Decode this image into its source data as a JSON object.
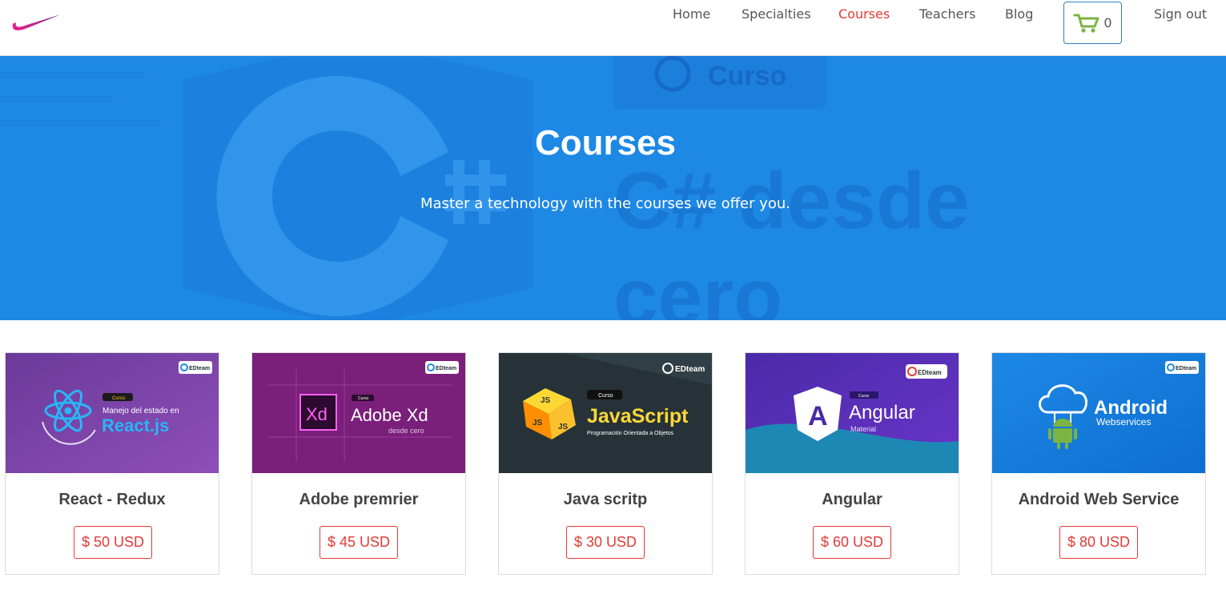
{
  "nav": {
    "items": [
      "Home",
      "Specialties",
      "Courses",
      "Teachers",
      "Blog"
    ],
    "cart_count": "0",
    "sign_out": "Sign out",
    "accent_color": "#e53935"
  },
  "hero": {
    "title": "Courses",
    "subtitle": "Master a technology with the courses we offer you.",
    "background_color": "#1e88e5",
    "bg_badge_text": "Curso",
    "bg_big_text_1": "C# desde",
    "bg_big_text_2": "cero"
  },
  "courses": [
    {
      "title": "React - Redux",
      "price": "$ 50 USD",
      "thumb": {
        "badge": "EDteam",
        "tag": "Curso",
        "line1": "Manejo del estado en",
        "line2": "React.js",
        "bg": "#7b3fa0"
      }
    },
    {
      "title": "Adobe premrier",
      "price": "$ 45 USD",
      "thumb": {
        "badge": "EDteam",
        "tag": "Curso",
        "logo": "Xd",
        "line1": "Adobe Xd",
        "line2": "desde cero",
        "bg": "#7a1f7a"
      }
    },
    {
      "title": "Java scritp",
      "price": "$ 30 USD",
      "thumb": {
        "badge": "EDteam",
        "tag": "Curso",
        "cube_label": "JS",
        "line1": "JavaScript",
        "line2": "Programación Orientada a Objetos",
        "bg": "#263238"
      }
    },
    {
      "title": "Angular",
      "price": "$ 60 USD",
      "thumb": {
        "badge": "EDteam",
        "tag": "Curso",
        "logo": "A",
        "line1": "Angular",
        "line2": "Material",
        "bg": "#5c2db5"
      }
    },
    {
      "title": "Android Web Service",
      "price": "$ 80 USD",
      "thumb": {
        "badge": "EDteam",
        "line1": "Android",
        "line2": "Webservices",
        "bg": "#1e88e5"
      }
    }
  ]
}
